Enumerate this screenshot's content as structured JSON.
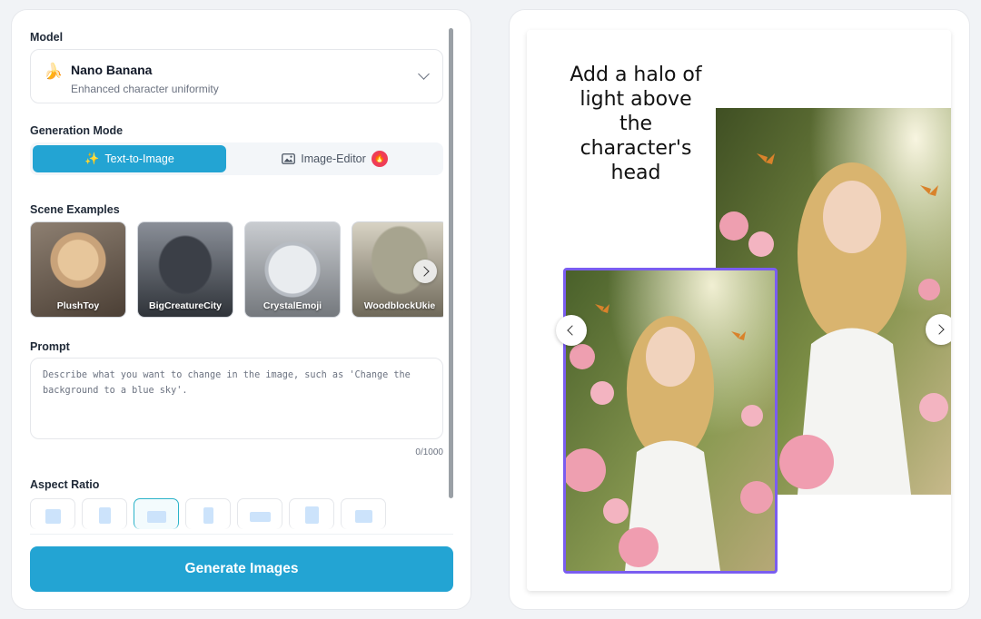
{
  "model": {
    "label": "Model",
    "emoji": "🍌",
    "name": "Nano Banana",
    "description": "Enhanced character uniformity"
  },
  "generation_mode": {
    "label": "Generation Mode",
    "modes": [
      {
        "label": "Text-to-Image",
        "icon": "sparkle-icon",
        "active": true
      },
      {
        "label": "Image-Editor",
        "icon": "image-icon",
        "active": false,
        "badge": "fire-icon"
      }
    ]
  },
  "scene_examples": {
    "label": "Scene Examples",
    "items": [
      {
        "label": "PlushToy"
      },
      {
        "label": "BigCreatureCity"
      },
      {
        "label": "CrystalEmoji"
      },
      {
        "label": "WoodblockUkie"
      }
    ]
  },
  "prompt": {
    "label": "Prompt",
    "placeholder": "Describe what you want to change in the image, such as 'Change the background to a blue sky'.",
    "count": "0/1000"
  },
  "aspect_ratio": {
    "label": "Aspect Ratio",
    "selected_index": 2
  },
  "generate": {
    "label": "Generate Images"
  },
  "preview": {
    "caption": "Add a halo of light above the character's head"
  },
  "colors": {
    "accent": "#23a4d3",
    "badge": "#ef3d57",
    "frame": "#7a5df0"
  }
}
